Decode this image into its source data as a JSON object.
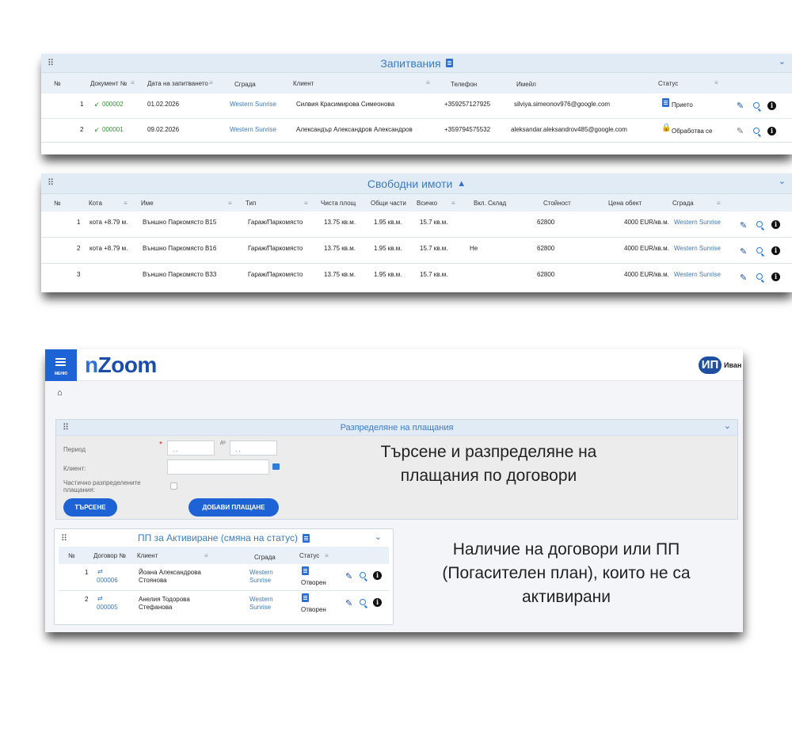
{
  "inquiries": {
    "title": "Запитвания",
    "columns": [
      "№",
      "Документ №",
      "Дата на запитването",
      "Сграда",
      "Клиент",
      "Телефон",
      "Имейл",
      "Статус"
    ],
    "rows": [
      {
        "num": "1",
        "doc": "000002",
        "date": "01.02.2026",
        "building": "Western Sunrise",
        "client": "Силвия Красимирова Симеонова",
        "phone": "+359257127925",
        "email": "silviya.simeonov976@google.com",
        "status": "Прието",
        "status_icon": "document-icon"
      },
      {
        "num": "2",
        "doc": "000001",
        "date": "09.02.2026",
        "building": "Western Sunrise",
        "client": "Александър Александров Александров",
        "phone": "+359794575532",
        "email": "aleksandar.aleksandrov485@google.com",
        "status": "Обработва се",
        "status_icon": "lock-icon"
      }
    ]
  },
  "properties": {
    "title": "Свободни имоти",
    "columns": [
      "№",
      "Кота",
      "Име",
      "Тип",
      "Чиста площ",
      "Общи части",
      "Всичко",
      "Вкл. Склад",
      "Стойност",
      "Цена обект",
      "Сграда"
    ],
    "rows": [
      {
        "num": "1",
        "level": "кота +8.79 м.",
        "name": "Външно Паркомясто В15",
        "type": "Гараж/Паркомясто",
        "net": "13.75 кв.м.",
        "common": "1.95 кв.м.",
        "total": "15.7 кв.м.",
        "storage": "",
        "value": "62800",
        "price": "4000 EUR/кв.м.",
        "building": "Western Sunrise"
      },
      {
        "num": "2",
        "level": "кота +8.79 м.",
        "name": "Външно Паркомясто В16",
        "type": "Гараж/Паркомясто",
        "net": "13.75 кв.м.",
        "common": "1.95 кв.м.",
        "total": "15.7 кв.м.",
        "storage": "Не",
        "value": "62800",
        "price": "4000 EUR/кв.м.",
        "building": "Western Sunrise"
      },
      {
        "num": "3",
        "level": "",
        "name": "Външно Паркомясто В33",
        "type": "Гараж/Паркомясто",
        "net": "13.75 кв.м.",
        "common": "1.95 кв.м.",
        "total": "15.7 кв.м.",
        "storage": "",
        "value": "62800",
        "price": "4000 EUR/кв.м.",
        "building": "Western Sunrise"
      }
    ]
  },
  "app": {
    "menu_label": "МЕНЮ",
    "logo_n": "n",
    "logo_rest": "Zoom",
    "avatar": "ИП",
    "user": "Иван",
    "payments": {
      "title": "Разпределяне на плащания",
      "period_label": "Период",
      "period_from": ". .",
      "period_to_label": "до",
      "period_to": ". .",
      "client_label": "Клиент:",
      "partial_label": "Частично разпределените плащания:",
      "search_button": "ТЪРСЕНЕ",
      "add_button": "ДОБАВИ ПЛАЩАНЕ"
    },
    "callout_1": "Търсене и разпределяне на плащания по договори",
    "callout_2": "Наличие на договори или ПП (Погасителен план), които не са активирани",
    "pp": {
      "title": "ПП за Активиране (смяна на статус)",
      "columns": [
        "№",
        "Договор №",
        "Клиент",
        "Сграда",
        "Статус"
      ],
      "rows": [
        {
          "num": "1",
          "contract": "000006",
          "client_1": "Йоана Александрова",
          "client_2": "Стоянова",
          "building_1": "Western",
          "building_2": "Sunrise",
          "status": "Отворен"
        },
        {
          "num": "2",
          "contract": "000005",
          "client_1": "Анелия Тодорова",
          "client_2": "Стефанова",
          "building_1": "Western",
          "building_2": "Sunrise",
          "status": "Отворен"
        }
      ]
    }
  },
  "colors": {
    "accent": "#1d63d6",
    "header_bg": "#e1ebf6",
    "title_blue": "#3a7cc4",
    "logo": "#1a4ea8"
  }
}
